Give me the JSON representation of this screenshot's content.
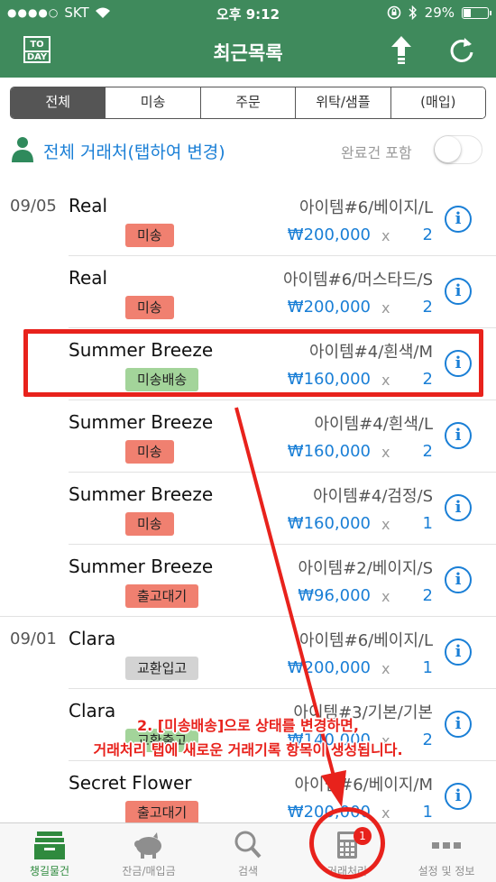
{
  "status_bar": {
    "carrier": "SKT",
    "time": "오후 9:12",
    "battery": "29%"
  },
  "header": {
    "title": "최근목록",
    "today_line1": "TO",
    "today_line2": "DAY"
  },
  "segments": [
    {
      "label": "전체",
      "active": true
    },
    {
      "label": "미송",
      "active": false
    },
    {
      "label": "주문",
      "active": false
    },
    {
      "label": "위탁/샘플",
      "active": false
    },
    {
      "label": "(매입)",
      "active": false
    }
  ],
  "filter": {
    "label": "전체 거래처(탭하여 변경)",
    "include_completed_label": "완료건 포함",
    "include_completed": false
  },
  "rows": [
    {
      "date": "09/05",
      "name": "Real",
      "item": "아이템#6/베이지/L",
      "badge": "미송",
      "badge_color": "red",
      "price": "₩200,000",
      "times": "x",
      "qty": "2"
    },
    {
      "date": "",
      "name": "Real",
      "item": "아이템#6/머스타드/S",
      "badge": "미송",
      "badge_color": "red",
      "price": "₩200,000",
      "times": "x",
      "qty": "2"
    },
    {
      "date": "",
      "name": "Summer Breeze",
      "item": "아이템#4/흰색/M",
      "badge": "미송배송",
      "badge_color": "green",
      "price": "₩160,000",
      "times": "x",
      "qty": "2"
    },
    {
      "date": "",
      "name": "Summer Breeze",
      "item": "아이템#4/흰색/L",
      "badge": "미송",
      "badge_color": "red",
      "price": "₩160,000",
      "times": "x",
      "qty": "2"
    },
    {
      "date": "",
      "name": "Summer Breeze",
      "item": "아이템#4/검정/S",
      "badge": "미송",
      "badge_color": "red",
      "price": "₩160,000",
      "times": "x",
      "qty": "1"
    },
    {
      "date": "",
      "name": "Summer Breeze",
      "item": "아이템#2/베이지/S",
      "badge": "출고대기",
      "badge_color": "red",
      "price": "₩96,000",
      "times": "x",
      "qty": "2"
    },
    {
      "date": "09/01",
      "name": "Clara",
      "item": "아이템#6/베이지/L",
      "badge": "교환입고",
      "badge_color": "gray",
      "price": "₩200,000",
      "times": "x",
      "qty": "1"
    },
    {
      "date": "",
      "name": "Clara",
      "item": "아이템#3/기본/기본",
      "badge": "교환출고",
      "badge_color": "green",
      "price": "₩140,000",
      "times": "x",
      "qty": "2"
    },
    {
      "date": "",
      "name": "Secret Flower",
      "item": "아이템#6/베이지/M",
      "badge": "출고대기",
      "badge_color": "red",
      "price": "₩200,000",
      "times": "x",
      "qty": "1"
    }
  ],
  "annotation": {
    "line1": "2. [미송배송]으로 상태를 변경하면,",
    "line2": "거래처리 탭에 새로운 거래기록 항목이 생성됩니다."
  },
  "tabs": [
    {
      "label": "챙길물건",
      "icon": "box-icon",
      "active": true
    },
    {
      "label": "잔금/매입금",
      "icon": "piggy-bank-icon",
      "active": false
    },
    {
      "label": "검색",
      "icon": "search-icon",
      "active": false
    },
    {
      "label": "거래처리",
      "icon": "calculator-icon",
      "active": false,
      "badge": "1"
    },
    {
      "label": "설정 및 정보",
      "icon": "more-icon",
      "active": false
    }
  ],
  "colors": {
    "nav_green": "#3f8a5c",
    "link_blue": "#1a7fd6",
    "annotation_red": "#e8221c",
    "badge_red": "#f08070",
    "badge_green": "#a3d49a",
    "badge_gray": "#d3d3d3"
  }
}
